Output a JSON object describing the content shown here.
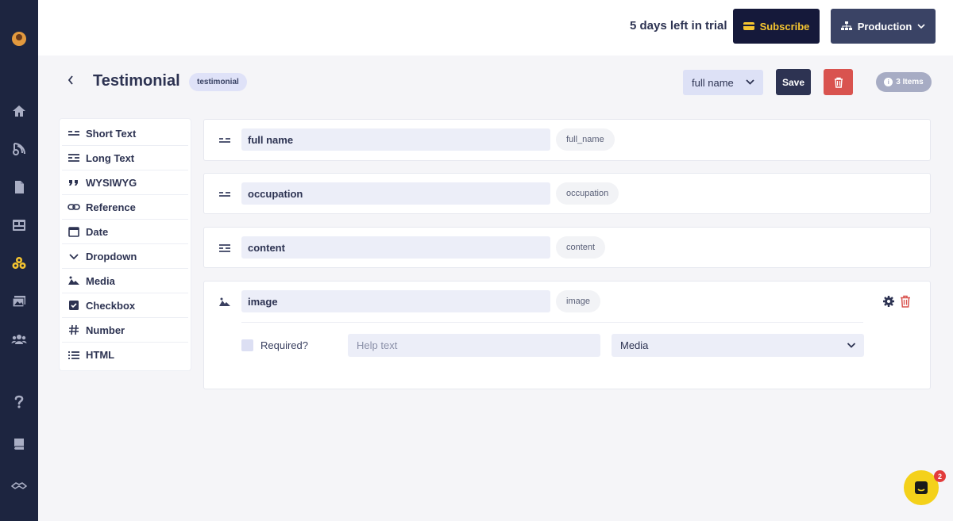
{
  "header": {
    "trial_text": "5 days left in trial",
    "subscribe_label": "Subscribe",
    "environment_label": "Production"
  },
  "leftnav": {
    "icons": [
      "avatar",
      "home-icon",
      "blog-icon",
      "file-icon",
      "layout-icon",
      "models-icon",
      "media-icon",
      "users-icon",
      "help-icon",
      "book-icon",
      "handshake-icon"
    ],
    "active": "models-icon",
    "accent": "#f4c430"
  },
  "model": {
    "title": "Testimonial",
    "slug": "testimonial",
    "sort_select": "full name",
    "save_label": "Save",
    "items_count": "3 Items"
  },
  "palette": {
    "items": [
      {
        "label": "Short Text",
        "icon": "short-text-icon"
      },
      {
        "label": "Long Text",
        "icon": "long-text-icon"
      },
      {
        "label": "WYSIWYG",
        "icon": "quote-icon"
      },
      {
        "label": "Reference",
        "icon": "link-icon"
      },
      {
        "label": "Date",
        "icon": "calendar-icon"
      },
      {
        "label": "Dropdown",
        "icon": "chevron-down-icon"
      },
      {
        "label": "Media",
        "icon": "image-icon"
      },
      {
        "label": "Checkbox",
        "icon": "checkbox-icon"
      },
      {
        "label": "Number",
        "icon": "hash-icon"
      },
      {
        "label": "HTML",
        "icon": "list-icon"
      }
    ]
  },
  "fields": [
    {
      "name": "full name",
      "key": "full_name",
      "icon": "short-text-icon"
    },
    {
      "name": "occupation",
      "key": "occupation",
      "icon": "short-text-icon"
    },
    {
      "name": "content",
      "key": "content",
      "icon": "long-text-icon"
    },
    {
      "name": "image",
      "key": "image",
      "icon": "image-icon",
      "expanded": {
        "required_label": "Required?",
        "help_placeholder": "Help text",
        "type_select": "Media"
      }
    }
  ],
  "chat": {
    "badge_count": "2"
  },
  "colors": {
    "danger": "#d9534f",
    "nav_bg": "#1d2540",
    "primary": "#2d3352"
  }
}
